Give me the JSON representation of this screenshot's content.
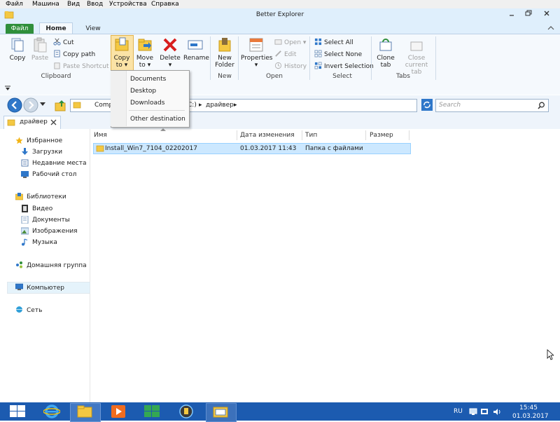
{
  "vm_menu": [
    "Файл",
    "Машина",
    "Вид",
    "Ввод",
    "Устройства",
    "Справка"
  ],
  "window": {
    "title": "Better Explorer"
  },
  "ribbon_tabs": {
    "file": "Файл",
    "home": "Home",
    "view": "View"
  },
  "clipboard": {
    "copy": "Copy",
    "paste": "Paste",
    "cut": "Cut",
    "copy_path": "Copy path",
    "paste_shortcut": "Paste Shortcut",
    "copy_to_1": "Copy",
    "copy_to_2": "to",
    "move_to_1": "Move",
    "move_to_2": "to",
    "delete": "Delete",
    "rename": "Rename",
    "label": "Clipboard"
  },
  "new_group": {
    "new_folder_1": "New",
    "new_folder_2": "Folder",
    "label": "New"
  },
  "open_group": {
    "properties": "Properties",
    "open": "Open",
    "edit": "Edit",
    "history": "History",
    "label": "Open"
  },
  "select_group": {
    "select_all": "Select All",
    "select_none": "Select None",
    "invert": "Invert Selection",
    "label": "Select"
  },
  "tabs_group": {
    "clone_1": "Clone",
    "clone_2": "tab",
    "close_1": "Close",
    "close_2": "current tab",
    "label": "Tabs"
  },
  "popup_menu": [
    "Documents",
    "Desktop",
    "Downloads",
    "Other destination"
  ],
  "address": {
    "seg1": "Comp",
    "seg2": "C:)",
    "seg3": "драйвер"
  },
  "search": {
    "placeholder": "Search"
  },
  "doc_tab": {
    "label": "драйвер"
  },
  "nav": {
    "favorites": "Избранное",
    "downloads": "Загрузки",
    "recent": "Недавние места",
    "desktop": "Рабочий стол",
    "libraries": "Библиотеки",
    "video": "Видео",
    "documents": "Документы",
    "images": "Изображения",
    "music": "Музыка",
    "homegroup": "Домашняя группа",
    "computer": "Компьютер",
    "network": "Сеть"
  },
  "columns": {
    "name": "Имя",
    "date": "Дата изменения",
    "type": "Тип",
    "size": "Размер"
  },
  "files": [
    {
      "name": "Install_Win7_7104_02202017",
      "date": "01.03.2017 11:43",
      "type": "Папка с файлами",
      "size": ""
    }
  ],
  "tray": {
    "lang": "RU",
    "time": "15:45",
    "date": "01.03.2017"
  },
  "colors": {
    "accent": "#2f8f3b",
    "taskbar": "#1c5bb0",
    "selection": "#cce8ff"
  }
}
